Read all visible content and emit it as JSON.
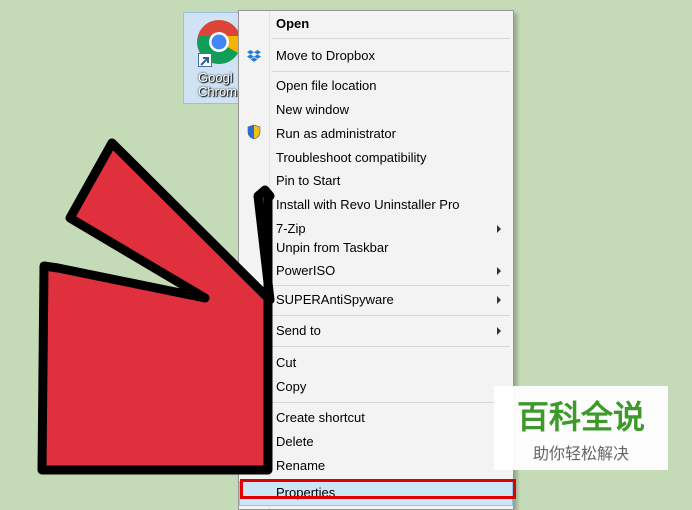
{
  "desktop": {
    "icon": {
      "label": "Googl\nChrom",
      "icon": "chrome-logo"
    }
  },
  "context_menu": {
    "items": [
      {
        "label": "Open",
        "bold": true
      },
      {
        "label": "Move to Dropbox",
        "icon": "dropbox-icon"
      },
      {
        "label": "Open file location"
      },
      {
        "label": "New window"
      },
      {
        "label": "Run as administrator",
        "icon": "uac-shield-icon"
      },
      {
        "label": "Troubleshoot compatibility"
      },
      {
        "label": "Pin to Start"
      },
      {
        "label": "Install with Revo Uninstaller Pro"
      },
      {
        "label": "7-Zip",
        "submenu": true
      },
      {
        "label": "Unpin from Taskbar"
      },
      {
        "label": "PowerISO",
        "submenu": true
      },
      {
        "label": "SUPERAntiSpyware",
        "submenu": true
      },
      {
        "label": "Send to",
        "submenu": true
      },
      {
        "label": "Cut"
      },
      {
        "label": "Copy"
      },
      {
        "label": "Create shortcut"
      },
      {
        "label": "Delete"
      },
      {
        "label": "Rename"
      },
      {
        "label": "Properties",
        "highlighted": true
      }
    ]
  },
  "annotation": {
    "arrow_color": "#e0303e",
    "frame_color": "#e00000"
  },
  "watermark": {
    "title": "百科全说",
    "subtitle": "助你轻松解决"
  }
}
